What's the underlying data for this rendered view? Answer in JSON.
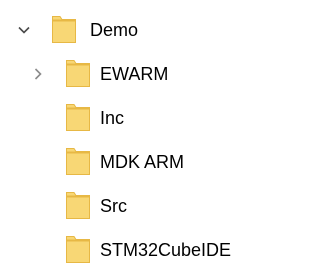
{
  "colors": {
    "folder_fill": "#f8d775",
    "folder_shade": "#e7b845",
    "chevron": "#4a4a4a",
    "text": "#000000"
  },
  "tree": {
    "root": {
      "label": "Demo",
      "icon": "folder-icon",
      "expander": "chevron-down-icon",
      "expanded": true
    },
    "children": [
      {
        "label": "EWARM",
        "icon": "folder-icon",
        "expander": "chevron-right-icon",
        "expanded": false
      },
      {
        "label": "Inc",
        "icon": "folder-icon"
      },
      {
        "label": "MDK ARM",
        "icon": "folder-icon"
      },
      {
        "label": "Src",
        "icon": "folder-icon"
      },
      {
        "label": "STM32CubeIDE",
        "icon": "folder-icon"
      }
    ]
  }
}
